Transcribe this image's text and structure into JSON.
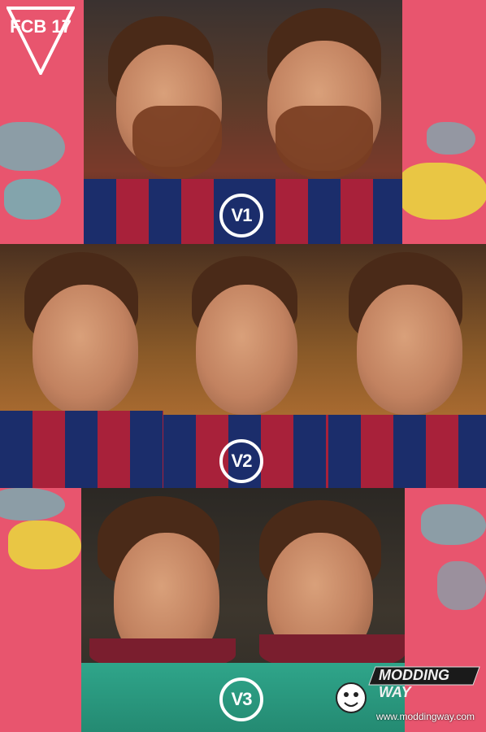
{
  "badges": {
    "v1": "V1",
    "v2": "V2",
    "v3": "V3"
  },
  "logo": {
    "club_text": "FCB 17"
  },
  "watermark": {
    "brand": "MODDING WAY",
    "url": "www.moddingway.com"
  },
  "colors": {
    "pink": "#e8556e",
    "cyan": "#3fd9d6",
    "yellow": "#e8e23a",
    "blaugrana_blue": "#1b2d6b",
    "blaugrana_red": "#a8213a",
    "green_kit": "#2fa58a"
  }
}
